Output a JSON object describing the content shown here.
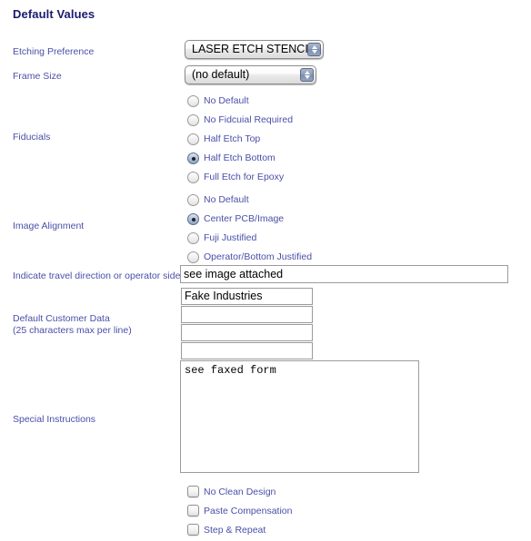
{
  "page": {
    "title": "Default Values",
    "title_color": "#1a1a6e",
    "label_color": "#4a4fa8",
    "background": "#ffffff"
  },
  "fields": {
    "etching_preference": {
      "label": "Etching Preference",
      "value": "LASER ETCH STENCIL"
    },
    "frame_size": {
      "label": "Frame Size",
      "value": "(no default)"
    },
    "fiducials": {
      "label": "Fiducials",
      "options": [
        {
          "label": "No Default",
          "selected": false
        },
        {
          "label": "No Fidcuial Required",
          "selected": false
        },
        {
          "label": "Half Etch Top",
          "selected": false
        },
        {
          "label": "Half Etch Bottom",
          "selected": true
        },
        {
          "label": "Full Etch for Epoxy",
          "selected": false
        }
      ]
    },
    "image_alignment": {
      "label": "Image Alignment",
      "options": [
        {
          "label": "No Default",
          "selected": false
        },
        {
          "label": "Center PCB/Image",
          "selected": true
        },
        {
          "label": "Fuji Justified",
          "selected": false
        },
        {
          "label": "Operator/Bottom Justified",
          "selected": false
        }
      ]
    },
    "travel_direction": {
      "label": "Indicate travel direction or operator side",
      "value": "see image attached"
    },
    "customer_data": {
      "label_line1": "Default Customer Data",
      "label_line2": "(25 characters max per line)",
      "values": [
        "Fake Industries",
        "",
        "",
        ""
      ]
    },
    "special_instructions": {
      "label": "Special Instructions",
      "value": "see faxed form"
    },
    "checkboxes": [
      {
        "label": "No Clean Design",
        "checked": false
      },
      {
        "label": "Paste Compensation",
        "checked": false
      },
      {
        "label": "Step & Repeat",
        "checked": false
      }
    ]
  }
}
